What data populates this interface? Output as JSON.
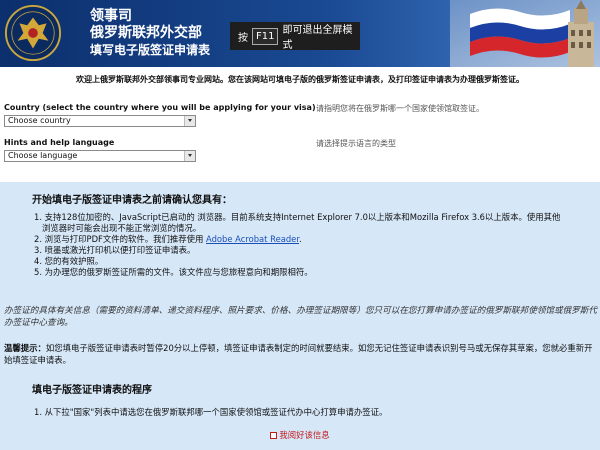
{
  "header": {
    "title_line1": "领事司",
    "title_line2": "俄罗斯联邦外交部",
    "title_line3": "填写电子版签证申请表",
    "fullscreen_prefix": "按",
    "fullscreen_key": "F11",
    "fullscreen_suffix": "即可退出全屏模式"
  },
  "intro": "欢迎上俄罗斯联邦外交部领事司专业网站。您在该网站可填电子版的俄罗斯签证申请表，及打印签证申请表为办理俄罗斯签证。",
  "country": {
    "label": "Country (select the country where you will be applying for your visa)",
    "selected": "Choose country",
    "hint": "请指明您将在俄罗斯哪一个国家使领馆取签证。"
  },
  "language": {
    "label": "Hints and help language",
    "selected": "Choose language",
    "hint": "请选择提示语言的类型"
  },
  "panel": {
    "heading": "开始填电子版签证申请表之前请确认您具有：",
    "req1a": "1. 支持128位加密的、JavaScript已启动的 浏览器。目前系统支持Internet Explorer 7.0以上版本和Mozilla Firefox 3.6以上版本。使用其他",
    "req1b": "浏览器时可能会出现不能正常浏览的情况。",
    "req2_prefix": "2. 浏览与打印PDF文件的软件。我们推荐使用",
    "req2_link": "Adobe Acrobat Reader",
    "req2_suffix": ".",
    "req3": "3. 喷墨或激光打印机以便打印签证申请表。",
    "req4": "4. 您的有效护照。",
    "req5": "5. 为办理您的俄罗斯签证所需的文件。该文件应与您旅程意向和期限相符。",
    "note": "办签证的具体有关信息（需要的资料清单、递交资料程序、照片要求、价格、办理签证期限等）您只可以在您打算申请办签证的俄罗斯联邦使领馆或俄罗斯代办签证中心查询。",
    "warn_label": "温馨提示：",
    "warn_text": "如您填电子版签证申请表时暂停20分以上停顿，填签证申请表制定的时间就要结束。如您无记住签证申请表识别号马或无保存其草案，您就必重新开始填签证申请表。",
    "proc_heading": "填电子版签证申请表的程序",
    "proc1": "1. 从下拉\"国家\"列表中请选您在俄罗斯联邦哪一个国家使领馆或签证代办中心打算申请办签证。",
    "ack": "我阅好该信息"
  },
  "colors": {
    "header_blue": "#0c2f6d",
    "panel_bg": "#d6e7f8",
    "link": "#1a4fb8",
    "ack_red": "#c21a1a"
  }
}
